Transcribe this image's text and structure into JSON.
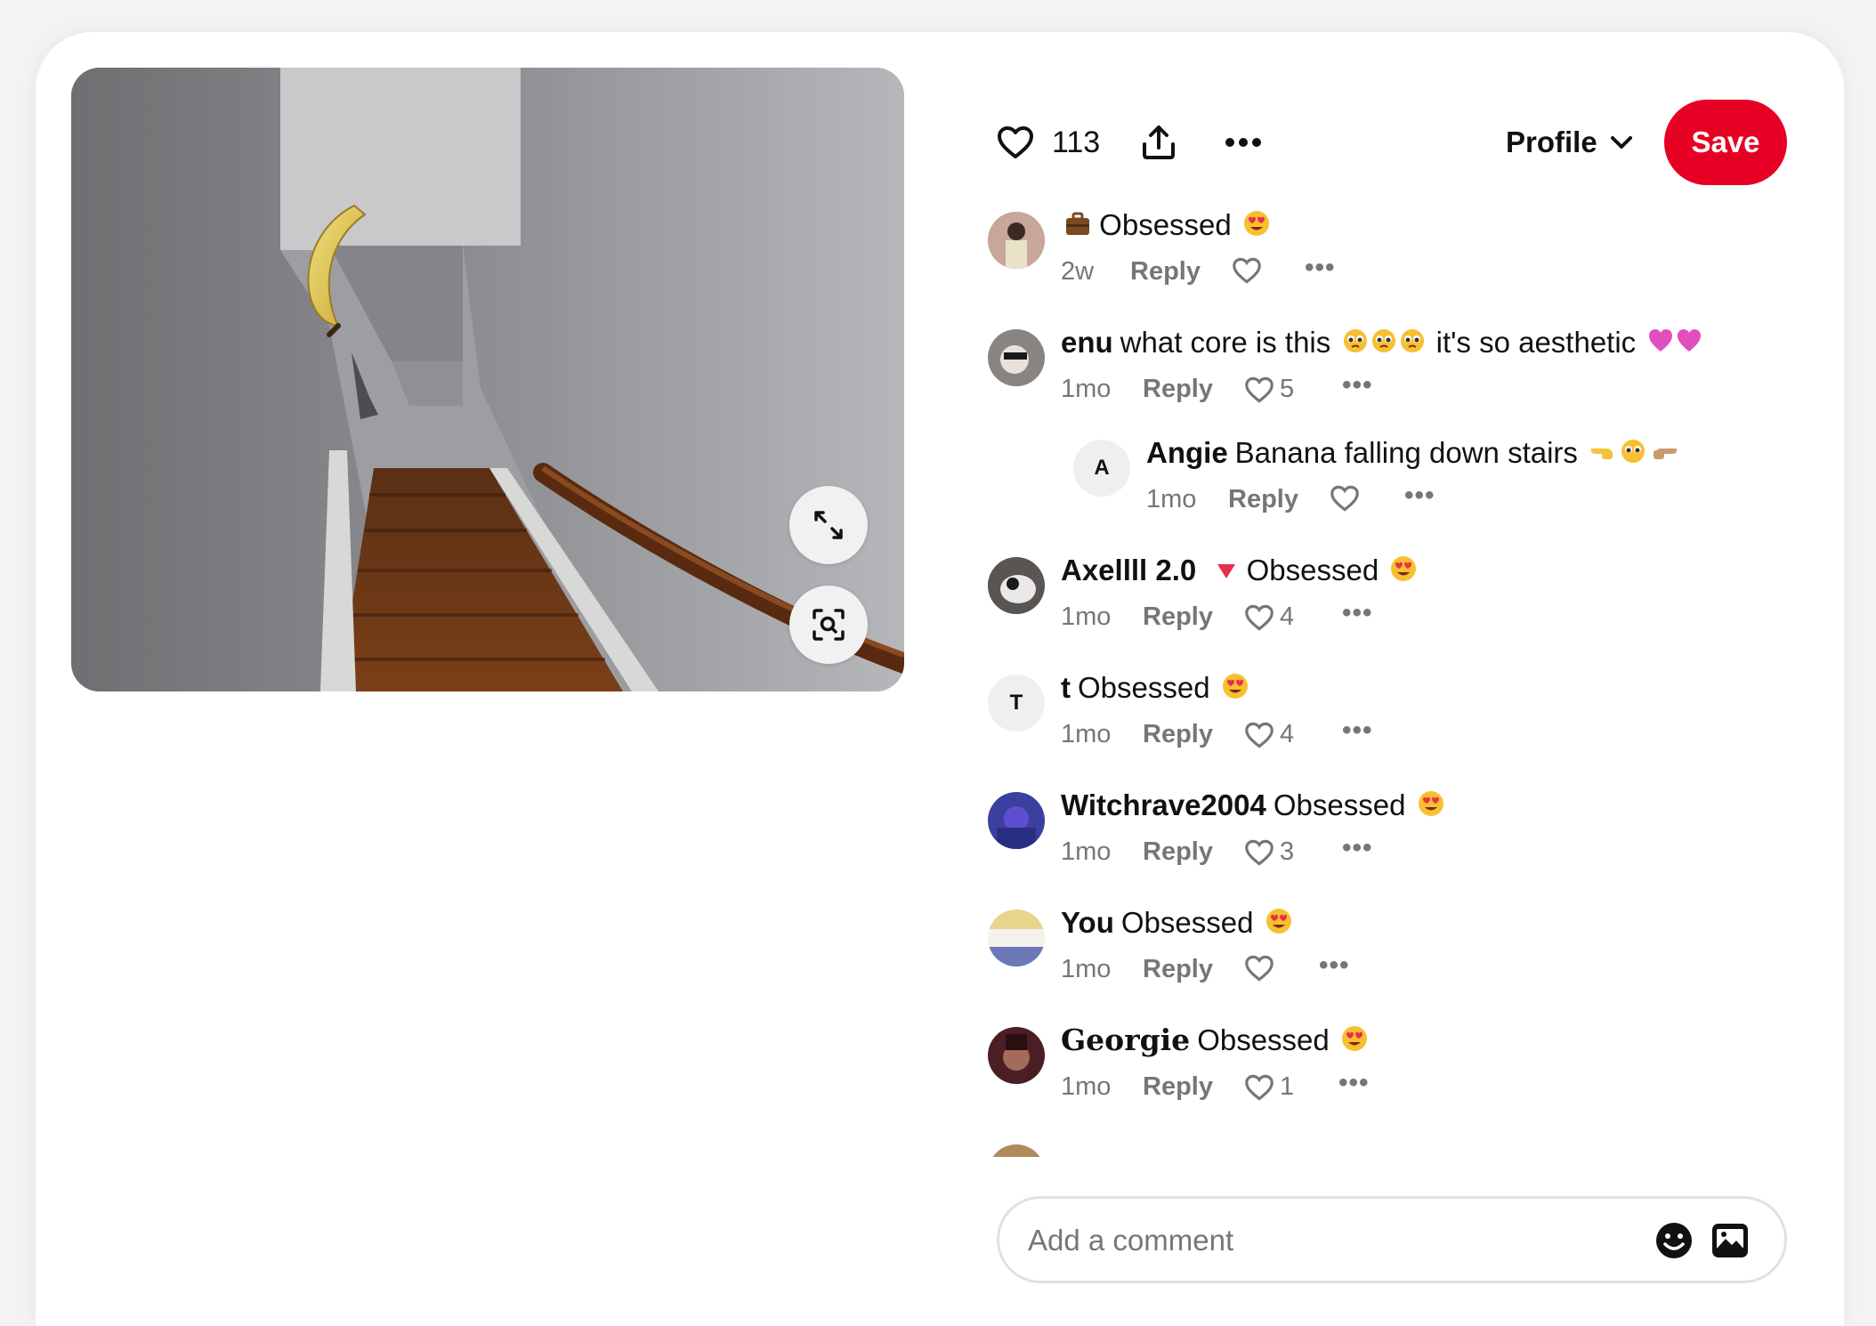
{
  "actions": {
    "like_count": "113",
    "profile_label": "Profile",
    "save_label": "Save"
  },
  "comments": [
    {
      "author": "",
      "author_prefix_emoji": "briefcase",
      "text": "Obsessed",
      "time": "2w",
      "reply": "Reply",
      "likes": "",
      "avatar_color": "#b79a8c"
    },
    {
      "author": "enu",
      "text": "what core is this",
      "text2": "it's so aesthetic",
      "time": "1mo",
      "reply": "Reply",
      "likes": "5",
      "avatar_color": "#8a8480"
    },
    {
      "author": "Angie",
      "text": "Banana falling down stairs",
      "time": "1mo",
      "reply": "Reply",
      "likes": "",
      "avatar_letter": "A"
    },
    {
      "author": "Axellll 2.0",
      "text": "Obsessed",
      "time": "1mo",
      "reply": "Reply",
      "likes": "4",
      "avatar_color": "#5b5552"
    },
    {
      "author": "t",
      "text": "Obsessed",
      "time": "1mo",
      "reply": "Reply",
      "likes": "4",
      "avatar_letter": "T"
    },
    {
      "author": "Witchrave2004",
      "text": "Obsessed",
      "time": "1mo",
      "reply": "Reply",
      "likes": "3",
      "avatar_color": "#3b3f9e"
    },
    {
      "author": "You",
      "text": "Obsessed",
      "time": "1mo",
      "reply": "Reply",
      "likes": "",
      "avatar_color": "#d9c48a"
    },
    {
      "author": "Georgie",
      "text": "Obsessed",
      "time": "1mo",
      "reply": "Reply",
      "likes": "1",
      "avatar_color": "#4a1f24"
    }
  ],
  "comment_input": {
    "placeholder": "Add a comment"
  },
  "colors": {
    "accent": "#e60023",
    "muted_text": "#767676"
  },
  "icons": [
    "heart-icon",
    "share-icon",
    "more-icon",
    "chevron-down-icon",
    "expand-icon",
    "visual-search-icon",
    "emoji-icon",
    "image-icon"
  ]
}
